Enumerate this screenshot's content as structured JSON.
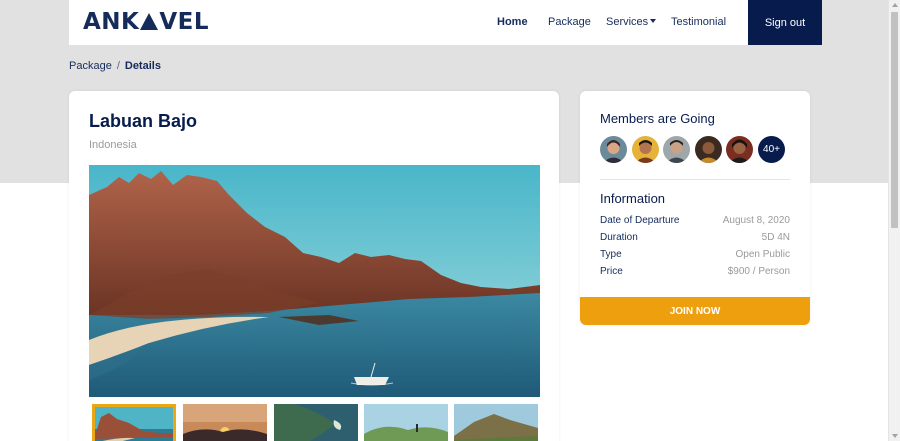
{
  "nav": {
    "brand_prefix": "ANK",
    "brand_suffix": "VEL",
    "links": [
      {
        "label": "Home",
        "active": true
      },
      {
        "label": "Package"
      },
      {
        "label": "Services"
      },
      {
        "label": "Testimonial"
      }
    ],
    "signout_label": "Sign out"
  },
  "breadcrumb": {
    "items": [
      "Package",
      "Details"
    ],
    "separator": "/"
  },
  "destination": {
    "title": "Labuan Bajo",
    "country": "Indonesia"
  },
  "gallery": {
    "thumbnails": [
      {
        "name": "mountain-bay",
        "active": true
      },
      {
        "name": "sunset-hills",
        "active": false
      },
      {
        "name": "aerial-island",
        "active": false
      },
      {
        "name": "hilltop-person",
        "active": false
      },
      {
        "name": "green-hill",
        "active": false
      }
    ]
  },
  "members": {
    "title": "Members are Going",
    "more_label": "40+"
  },
  "information": {
    "title": "Information",
    "rows": [
      {
        "label": "Date of Departure",
        "value": "August 8, 2020"
      },
      {
        "label": "Duration",
        "value": "5D 4N"
      },
      {
        "label": "Type",
        "value": "Open Public"
      },
      {
        "label": "Price",
        "value": "$900 / Person"
      }
    ]
  },
  "cta": {
    "label": "JOIN NOW"
  },
  "colors": {
    "navy": "#071c4d",
    "accent_orange": "#ed9f0e",
    "active_border": "#e9a915",
    "muted_text": "#9a9a9a",
    "header_band": "#e1e1e1"
  },
  "icons": [
    "caret-down-icon",
    "triangle-logo-mark-icon"
  ]
}
